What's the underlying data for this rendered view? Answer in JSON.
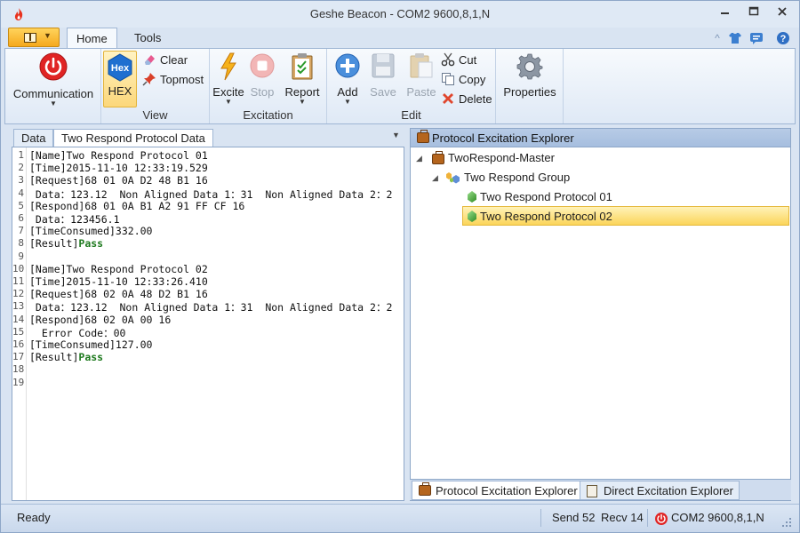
{
  "window": {
    "title": "Geshe Beacon - COM2  9600,8,1,N"
  },
  "ribbon_tabs": [
    "Home",
    "Tools"
  ],
  "ribbon": {
    "communication_label": "Communication",
    "view": {
      "group_label": "View",
      "hex_label": "HEX",
      "hex_badge": "Hex",
      "clear_label": "Clear",
      "topmost_label": "Topmost"
    },
    "excitation": {
      "group_label": "Excitation",
      "excite_label": "Excite",
      "stop_label": "Stop",
      "report_label": "Report"
    },
    "edit": {
      "group_label": "Edit",
      "add_label": "Add",
      "save_label": "Save",
      "paste_label": "Paste",
      "cut_label": "Cut",
      "copy_label": "Copy",
      "delete_label": "Delete"
    },
    "properties_label": "Properties"
  },
  "document_tabs": [
    "Data",
    "Two Respond Protocol Data"
  ],
  "editor_lines": [
    {
      "n": "1",
      "text": "[Name]Two Respond Protocol 01",
      "pass": ""
    },
    {
      "n": "2",
      "text": "[Time]2015-11-10 12:33:19.529",
      "pass": ""
    },
    {
      "n": "3",
      "text": "[Request]68 01 0A D2 48 B1 16",
      "pass": ""
    },
    {
      "n": "4",
      "text": " Data：123.12  Non Aligned Data 1：31  Non Aligned Data 2：2",
      "pass": ""
    },
    {
      "n": "5",
      "text": "[Respond]68 01 0A B1 A2 91 FF CF 16",
      "pass": ""
    },
    {
      "n": "6",
      "text": " Data：123456.1",
      "pass": ""
    },
    {
      "n": "7",
      "text": "[TimeConsumed]332.00",
      "pass": ""
    },
    {
      "n": "8",
      "text": "[Result]",
      "pass": "Pass"
    },
    {
      "n": "9",
      "text": "",
      "pass": ""
    },
    {
      "n": "10",
      "text": "[Name]Two Respond Protocol 02",
      "pass": ""
    },
    {
      "n": "11",
      "text": "[Time]2015-11-10 12:33:26.410",
      "pass": ""
    },
    {
      "n": "12",
      "text": "[Request]68 02 0A 48 D2 B1 16",
      "pass": ""
    },
    {
      "n": "13",
      "text": " Data：123.12  Non Aligned Data 1：31  Non Aligned Data 2：2",
      "pass": ""
    },
    {
      "n": "14",
      "text": "[Respond]68 02 0A 00 16",
      "pass": ""
    },
    {
      "n": "15",
      "text": "  Error Code：00",
      "pass": ""
    },
    {
      "n": "16",
      "text": "[TimeConsumed]127.00",
      "pass": ""
    },
    {
      "n": "17",
      "text": "[Result]",
      "pass": "Pass"
    },
    {
      "n": "18",
      "text": "",
      "pass": ""
    },
    {
      "n": "19",
      "text": "",
      "pass": ""
    }
  ],
  "explorer": {
    "title": "Protocol Excitation Explorer",
    "tree": {
      "master": "TwoRespond-Master",
      "group": "Two Respond Group",
      "protocols": [
        "Two Respond Protocol 01",
        "Two Respond Protocol 02"
      ],
      "selected_index": 1
    },
    "bottom_tabs": [
      "Protocol Excitation Explorer",
      "Direct Excitation Explorer"
    ]
  },
  "status": {
    "ready": "Ready",
    "send": "Send 52",
    "recv": "Recv 14",
    "port": "COM2  9600,8,1,N"
  },
  "colors": {
    "accent": "#2b5797",
    "selected_row": "#fbd55a",
    "pass_text": "#1f7a1f",
    "power_red": "#e02424"
  }
}
